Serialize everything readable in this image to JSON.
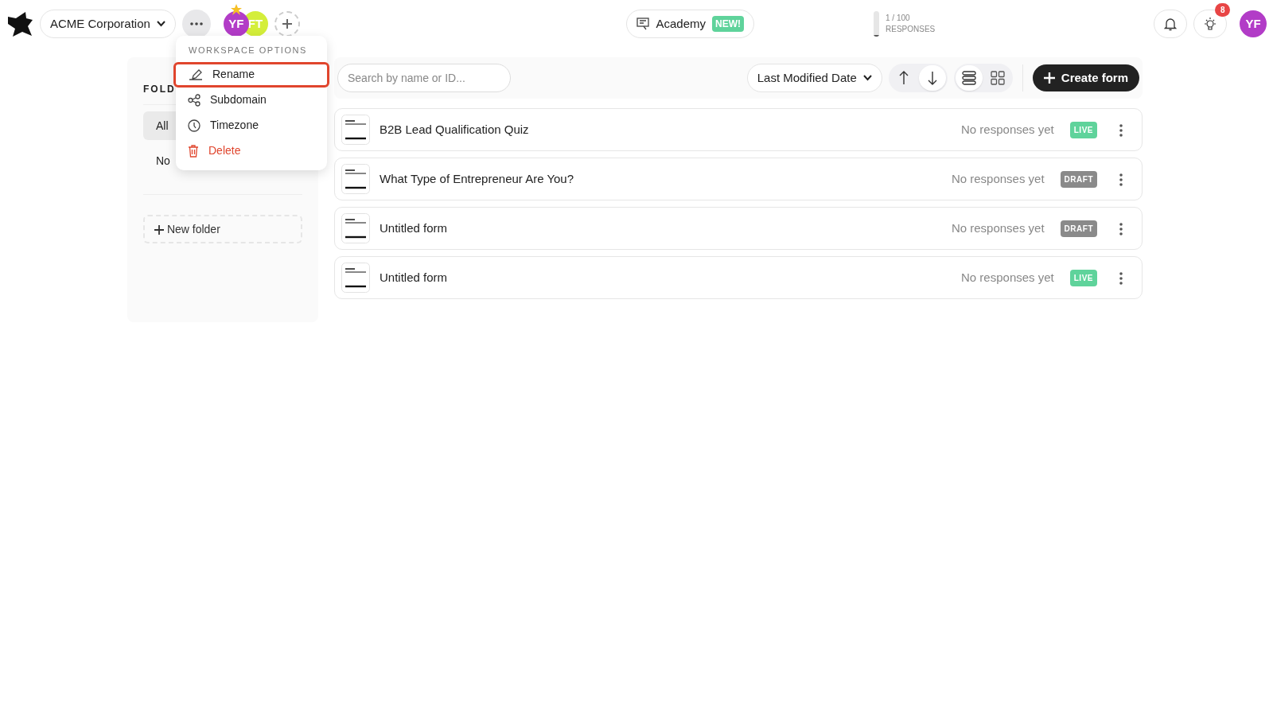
{
  "header": {
    "workspace": "ACME Corporation",
    "members": [
      {
        "initials": "YF",
        "color": "#b23cc7",
        "owner": true
      },
      {
        "initials": "FT",
        "color": "#d4ee3a",
        "owner": false
      }
    ],
    "academy": {
      "label": "Academy",
      "badge": "NEW!"
    },
    "usage": {
      "count": "1 / 100",
      "label": "RESPONSES",
      "level": 0.01
    },
    "notifications_badge": "8",
    "user_initials": "YF"
  },
  "workspace_menu": {
    "title": "WORKSPACE OPTIONS",
    "items": [
      {
        "label": "Rename",
        "kind": "edit",
        "selected": true
      },
      {
        "label": "Subdomain",
        "kind": "share",
        "selected": false
      },
      {
        "label": "Timezone",
        "kind": "clock",
        "selected": false
      },
      {
        "label": "Delete",
        "kind": "delete",
        "selected": false
      }
    ]
  },
  "sidebar": {
    "title": "FOLD",
    "items": [
      {
        "label": "All",
        "selected": true
      },
      {
        "label": "No",
        "selected": false
      }
    ],
    "new_folder": "New folder"
  },
  "toolbar": {
    "search": {
      "placeholder": "Search by name or ID..."
    },
    "sort": "Last Modified Date",
    "direction": [
      {
        "kind": "up",
        "selected": false
      },
      {
        "kind": "down",
        "selected": true
      }
    ],
    "views": [
      {
        "kind": "list",
        "selected": true
      },
      {
        "kind": "grid",
        "selected": false
      }
    ],
    "create": "Create form"
  },
  "forms": [
    {
      "title": "B2B Lead Qualification Quiz",
      "responses": "No responses yet",
      "status": "LIVE",
      "kind": "live"
    },
    {
      "title": "What Type of Entrepreneur Are You?",
      "responses": "No responses yet",
      "status": "DRAFT",
      "kind": "draft"
    },
    {
      "title": "Untitled form",
      "responses": "No responses yet",
      "status": "DRAFT",
      "kind": "draft"
    },
    {
      "title": "Untitled form",
      "responses": "No responses yet",
      "status": "LIVE",
      "kind": "live"
    }
  ]
}
